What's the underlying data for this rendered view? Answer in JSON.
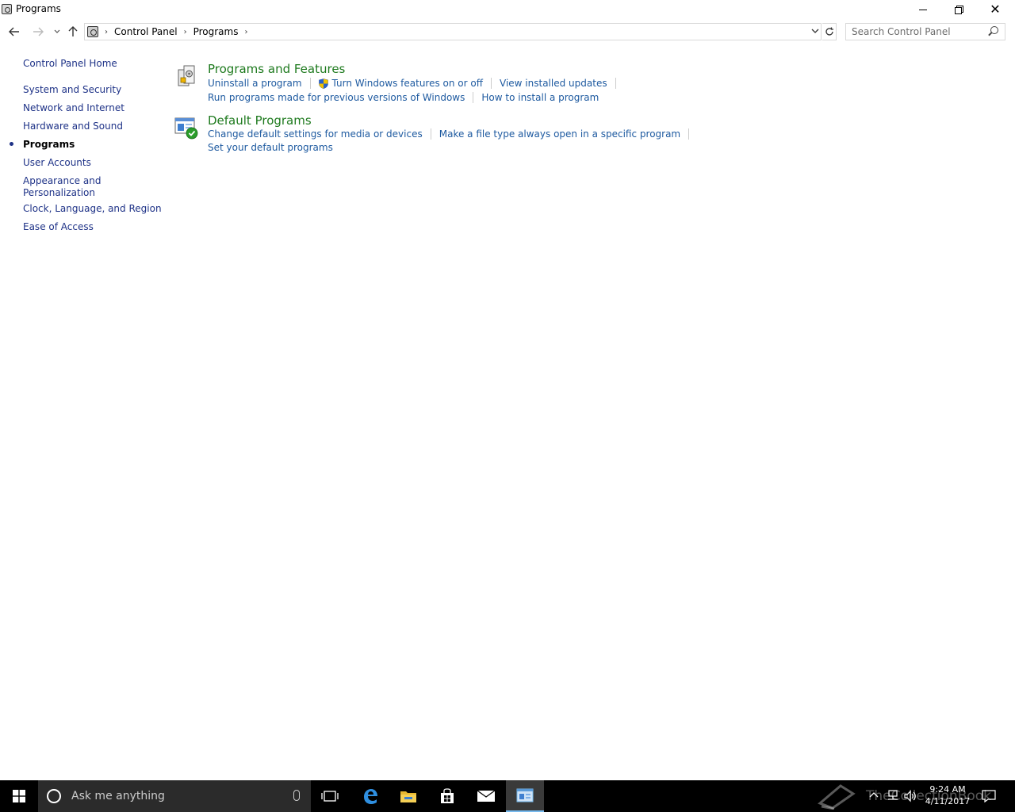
{
  "window": {
    "title": "Programs",
    "controls": {
      "minimize": "minimize",
      "maximize": "restore",
      "close": "✕"
    }
  },
  "navigation": {
    "breadcrumbs": [
      "Control Panel",
      "Programs"
    ],
    "search_placeholder": "Search Control Panel"
  },
  "sidebar": {
    "home": "Control Panel Home",
    "items": [
      {
        "label": "System and Security",
        "active": false
      },
      {
        "label": "Network and Internet",
        "active": false
      },
      {
        "label": "Hardware and Sound",
        "active": false
      },
      {
        "label": "Programs",
        "active": true
      },
      {
        "label": "User Accounts",
        "active": false
      },
      {
        "label": "Appearance and",
        "label2": "Personalization",
        "active": false
      },
      {
        "label": "Clock, Language, and Region",
        "active": false
      },
      {
        "label": "Ease of Access",
        "active": false
      }
    ]
  },
  "sections": [
    {
      "title": "Programs and Features",
      "tasks": {
        "uninstall": "Uninstall a program",
        "windows_features": "Turn Windows features on or off",
        "installed_updates": "View installed updates",
        "compatibility": "Run programs made for previous versions of Windows",
        "how_to_install": "How to install a program"
      }
    },
    {
      "title": "Default Programs",
      "tasks": {
        "media_defaults": "Change default settings for media or devices",
        "file_type": "Make a file type always open in a specific program",
        "set_defaults": "Set your default programs"
      }
    }
  ],
  "taskbar": {
    "search_placeholder": "Ask me anything",
    "time": "9:24 AM",
    "date": "4/11/2017",
    "watermark": "TheCollectionBook"
  },
  "colors": {
    "link": "#1e3287",
    "task_link": "#1e5aa0",
    "section_title": "#1e7a1e",
    "taskbar": "#000000",
    "active_indicator": "#76b9ed"
  }
}
